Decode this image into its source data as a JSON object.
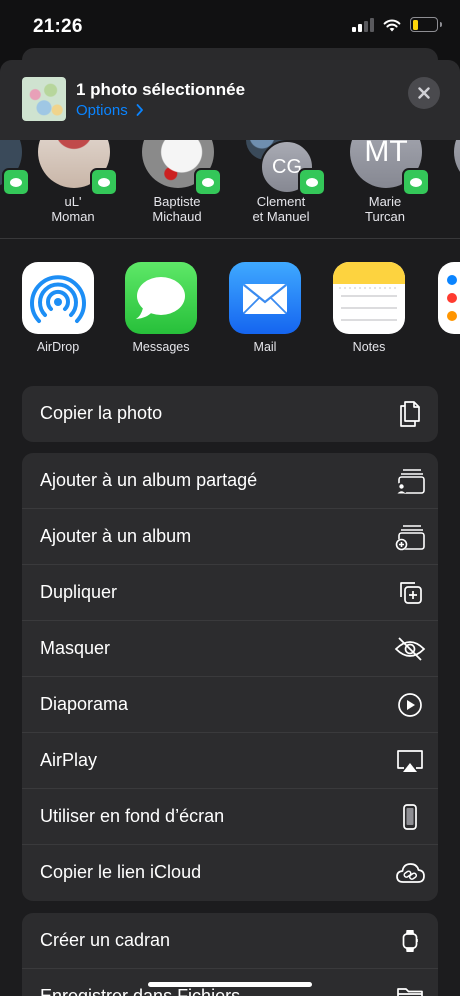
{
  "status": {
    "time": "21:26"
  },
  "header": {
    "title": "1 photo sélectionnée",
    "options_label": "Options"
  },
  "people": [
    {
      "name": ""
    },
    {
      "name": "uL'\nMoman"
    },
    {
      "name": "Baptiste\nMichaud"
    },
    {
      "name": "Clement\net Manuel",
      "initials": "CG"
    },
    {
      "name": "Marie\nTurcan",
      "initials": "MT"
    },
    {
      "name": ""
    }
  ],
  "apps": [
    {
      "label": "AirDrop"
    },
    {
      "label": "Messages"
    },
    {
      "label": "Mail"
    },
    {
      "label": "Notes"
    },
    {
      "label": "Ra"
    }
  ],
  "actions_group1": [
    {
      "label": "Copier la photo",
      "icon": "copy-icon"
    }
  ],
  "actions_group2": [
    {
      "label": "Ajouter à un album partagé",
      "icon": "shared-album-icon"
    },
    {
      "label": "Ajouter à un album",
      "icon": "add-album-icon"
    },
    {
      "label": "Dupliquer",
      "icon": "duplicate-icon"
    },
    {
      "label": "Masquer",
      "icon": "hide-icon"
    },
    {
      "label": "Diaporama",
      "icon": "play-icon"
    },
    {
      "label": "AirPlay",
      "icon": "airplay-icon"
    },
    {
      "label": "Utiliser en fond d’écran",
      "icon": "phone-icon"
    },
    {
      "label": "Copier le lien iCloud",
      "icon": "icloud-link-icon"
    }
  ],
  "actions_group3": [
    {
      "label": "Créer un cadran",
      "icon": "watch-icon"
    },
    {
      "label": "Enregistrer dans Fichiers",
      "icon": "folder-icon"
    }
  ],
  "colors": {
    "accent": "#0a84ff",
    "messages_green": "#34c759",
    "sheet_bg": "#1c1c1e",
    "row_bg": "#2c2c2e"
  }
}
